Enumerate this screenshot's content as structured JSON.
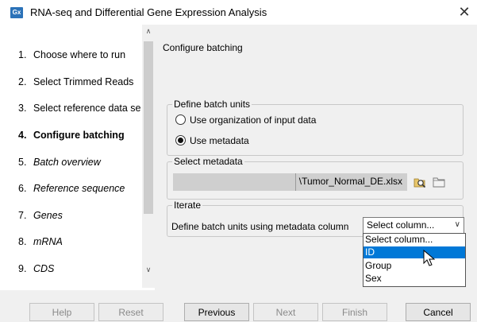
{
  "window": {
    "icon_text": "Gx",
    "title": "RNA-seq and Differential Gene Expression Analysis",
    "close_symbol": "✕"
  },
  "sidebar": {
    "steps": [
      {
        "num": "1.",
        "label": "Choose where to run"
      },
      {
        "num": "2.",
        "label": "Select Trimmed Reads"
      },
      {
        "num": "3.",
        "label": "Select reference data se"
      },
      {
        "num": "4.",
        "label": "Configure batching"
      },
      {
        "num": "5.",
        "label": "Batch overview"
      },
      {
        "num": "6.",
        "label": "Reference sequence"
      },
      {
        "num": "7.",
        "label": "Genes"
      },
      {
        "num": "8.",
        "label": "mRNA"
      },
      {
        "num": "9.",
        "label": "CDS"
      }
    ],
    "active_step": "4.",
    "scroll_up": "∧",
    "scroll_down": "∨",
    "scroll_left": "<",
    "scroll_right": ">"
  },
  "main": {
    "title": "Configure batching",
    "batch_units": {
      "legend": "Define batch units",
      "options": [
        {
          "label": "Use organization of input data",
          "selected": false
        },
        {
          "label": "Use metadata",
          "selected": true
        }
      ]
    },
    "metadata": {
      "legend": "Select metadata",
      "file_value": "\\Tumor_Normal_DE.xlsx",
      "browse_icon": "browse-icon",
      "folder_icon": "folder-icon"
    },
    "iterate": {
      "legend": "Iterate",
      "label": "Define batch units using metadata column",
      "select_value": "Select column...",
      "chevron": "∨",
      "dropdown_options": [
        "Select column...",
        "ID",
        "Group",
        "Sex"
      ],
      "highlighted_option": "ID"
    }
  },
  "footer": {
    "help": "Help",
    "reset": "Reset",
    "previous": "Previous",
    "next": "Next",
    "finish": "Finish",
    "cancel": "Cancel"
  },
  "colors": {
    "highlight": "#0078d7",
    "app_icon": "#2b72b8"
  }
}
